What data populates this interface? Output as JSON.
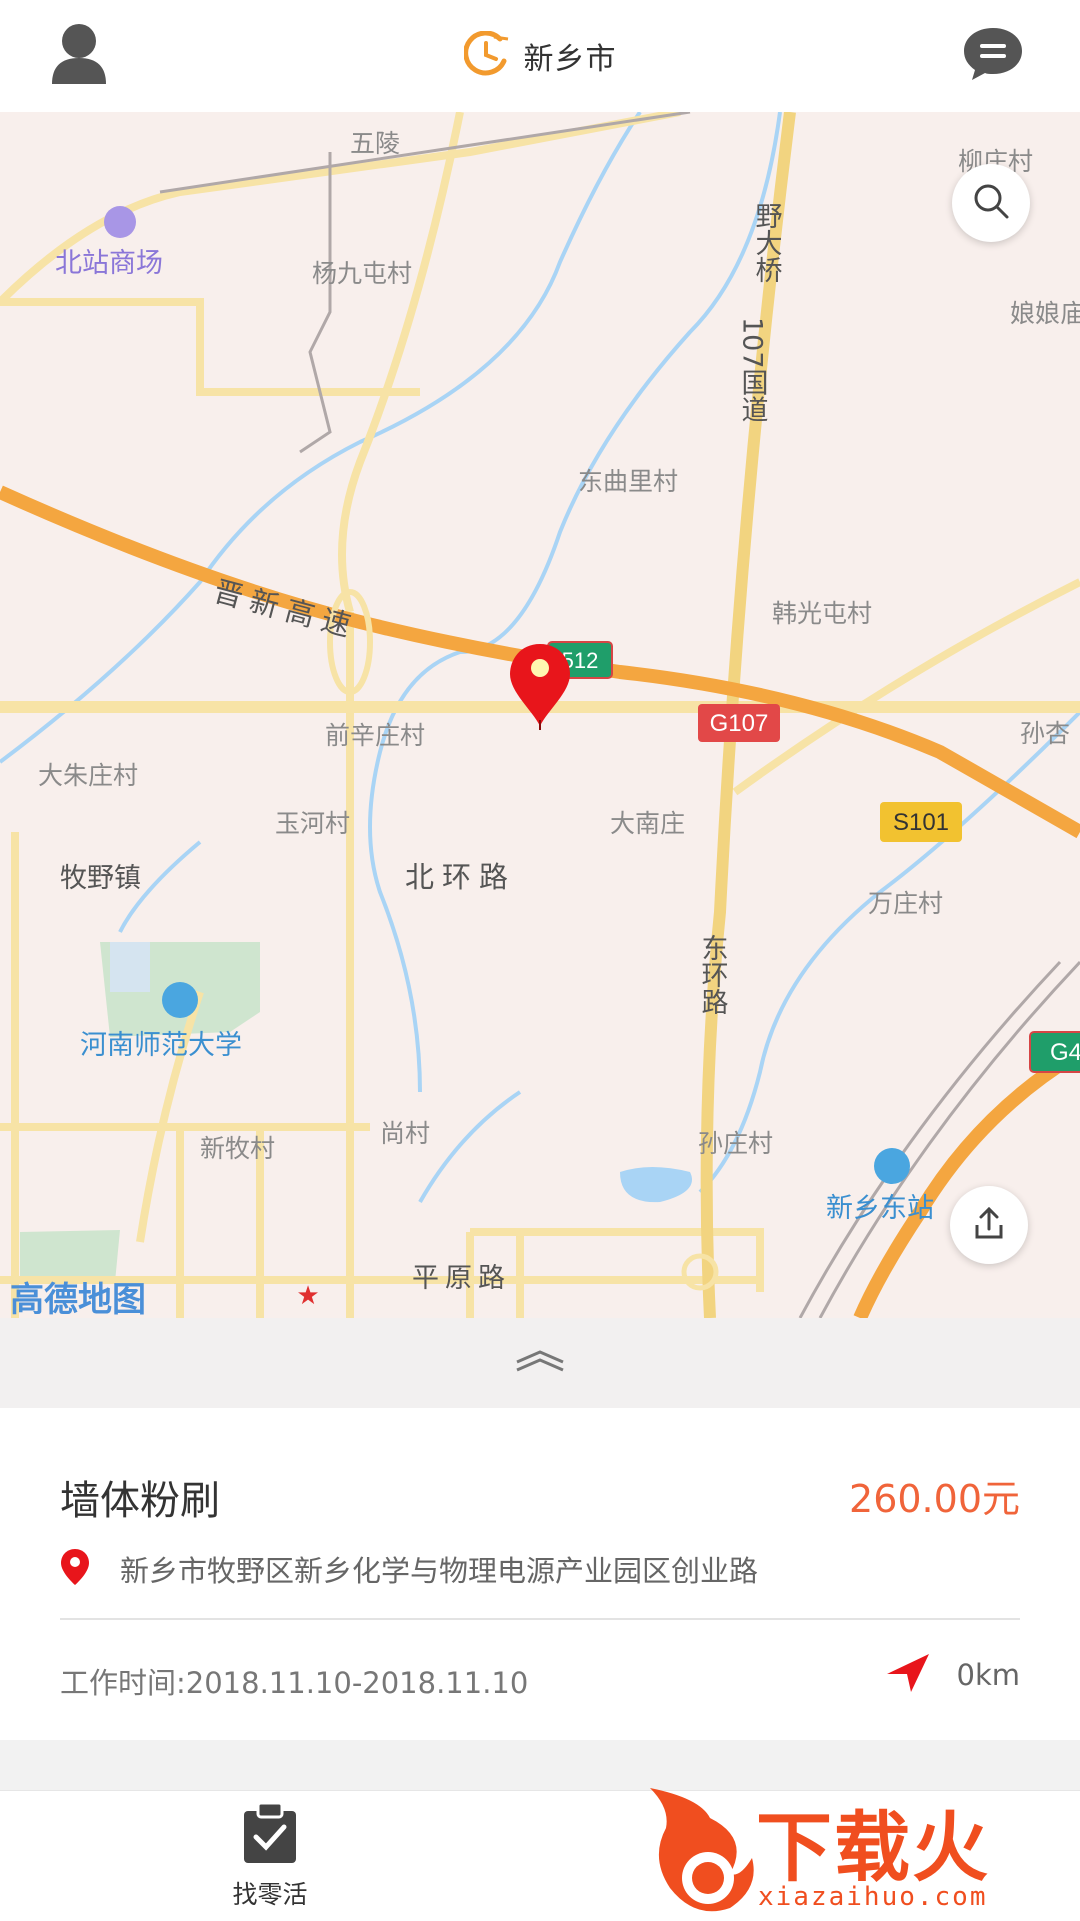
{
  "header": {
    "city": "新乡市"
  },
  "map": {
    "labels": [
      "五陵",
      "北站商场",
      "杨九屯村",
      "野大桥",
      "娘娘庙",
      "107国道",
      "东曲里村",
      "晋新高速",
      "韩光屯村",
      "前辛庄村",
      "大朱庄村",
      "孙杏",
      "玉河村",
      "大南庄",
      "牧野镇",
      "北环路",
      "万庄村",
      "东环路",
      "河南师范大学",
      "尚村",
      "新牧村",
      "孙庄村",
      "新乡东站",
      "平原路",
      "柳庄村"
    ],
    "road_shields": [
      "512",
      "G107",
      "S101",
      "G4"
    ],
    "logo": "高德地图"
  },
  "job": {
    "title": "墙体粉刷",
    "price": "260.00元",
    "address": "新乡市牧野区新乡化学与物理电源产业园区创业路",
    "work_time": "工作时间:2018.11.10-2018.11.10",
    "distance": "0km"
  },
  "nav": {
    "find_job_label": "找零活"
  },
  "watermark": {
    "text": "下载火",
    "url": "xiazaihuo.com"
  },
  "colors": {
    "accent": "#f0643a",
    "pin": "#e8151b",
    "road_major": "#f4a640",
    "road_minor": "#f7e3a6",
    "water": "#a9d4f5"
  }
}
